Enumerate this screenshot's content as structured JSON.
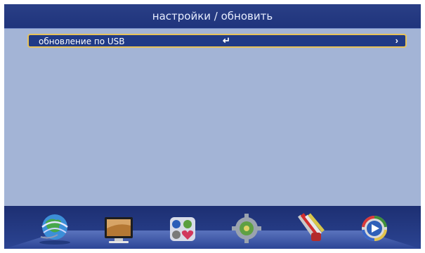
{
  "header": {
    "title": "настройки / обновить"
  },
  "menu": {
    "items": [
      {
        "label": "обновление по USB",
        "enter_glyph": "↵",
        "arrow_glyph": "›",
        "selected": true
      }
    ]
  },
  "dock": {
    "icons": [
      "globe-network-icon",
      "tv-monitor-icon",
      "media-apps-icon",
      "settings-gear-icon",
      "av-cables-icon",
      "play-button-icon"
    ]
  },
  "colors": {
    "background": "#a3b4d6",
    "title_bar": "#1f347c",
    "selection": "#203a86",
    "selection_border": "#e7c35a",
    "dock": "#1d2f72"
  }
}
